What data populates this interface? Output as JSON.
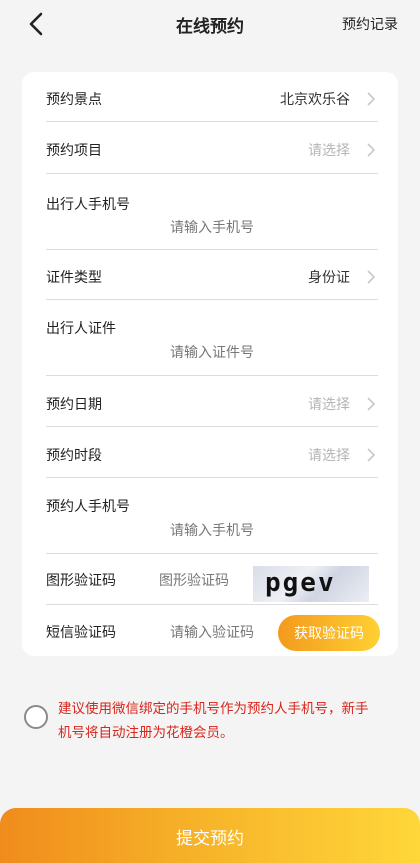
{
  "header": {
    "title": "在线预约",
    "records_link": "预约记录"
  },
  "form": {
    "attraction": {
      "label": "预约景点",
      "value": "北京欢乐谷"
    },
    "item": {
      "label": "预约项目",
      "placeholder": "请选择"
    },
    "traveler_phone": {
      "label": "出行人手机号",
      "placeholder": "请输入手机号"
    },
    "id_type": {
      "label": "证件类型",
      "value": "身份证"
    },
    "traveler_id": {
      "label": "出行人证件",
      "placeholder": "请输入证件号"
    },
    "date": {
      "label": "预约日期",
      "placeholder": "请选择"
    },
    "time_slot": {
      "label": "预约时段",
      "placeholder": "请选择"
    },
    "booker_phone": {
      "label": "预约人手机号",
      "placeholder": "请输入手机号"
    },
    "image_captcha": {
      "label": "图形验证码",
      "placeholder": "图形验证码",
      "captcha_text": "pgev"
    },
    "sms_code": {
      "label": "短信验证码",
      "placeholder": "请输入验证码",
      "button": "获取验证码"
    }
  },
  "agreement": {
    "text": "建议使用微信绑定的手机号作为预约人手机号，新手机号将自动注册为花橙会员。"
  },
  "submit_label": "提交预约",
  "colors": {
    "accent_orange": "#f08c1c",
    "accent_yellow": "#ffd73a",
    "warning_red": "#d9261c"
  }
}
